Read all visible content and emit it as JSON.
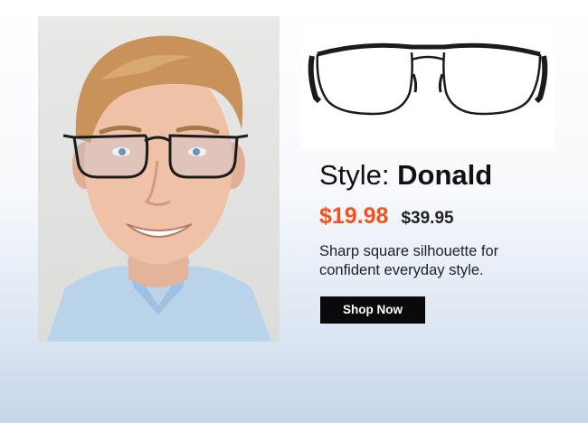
{
  "product": {
    "style_label": "Style:",
    "style_name": "Donald",
    "sale_price": "$19.98",
    "original_price": "$39.95",
    "description": "Sharp square silhouette for confident everyday style.",
    "cta_label": "Shop Now"
  },
  "colors": {
    "sale_price": "#f4511e",
    "button_bg": "#0a0a0a",
    "button_text": "#ffffff",
    "frame": "#1b1b1b"
  }
}
